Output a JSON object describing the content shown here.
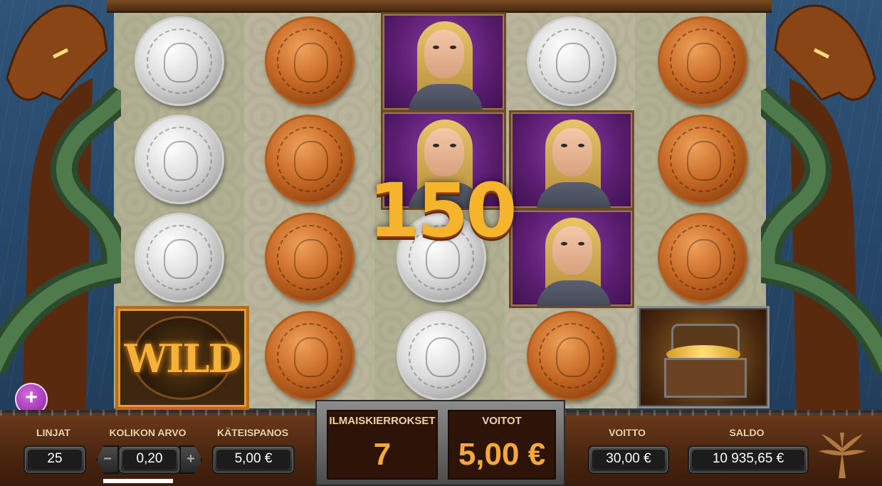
{
  "game": {
    "win_popup": "150",
    "wild_label": "WILD"
  },
  "reels": {
    "columns": [
      [
        "silver-coin",
        "silver-coin",
        "silver-coin",
        "wild"
      ],
      [
        "copper-coin",
        "copper-coin",
        "copper-coin",
        "copper-coin"
      ],
      [
        "viking-girl",
        "viking-girl",
        "silver-coin",
        "silver-coin"
      ],
      [
        "silver-coin",
        "viking-girl",
        "viking-girl",
        "copper-coin"
      ],
      [
        "copper-coin",
        "copper-coin",
        "copper-coin",
        "treasure-chest"
      ]
    ]
  },
  "controls": {
    "lines_label": "LINJAT",
    "lines_value": "25",
    "coin_value_label": "KOLIKON ARVO",
    "coin_value": "0,20",
    "decrease_symbol": "−",
    "increase_symbol": "+",
    "cash_bet_label": "KÄTEISPANOS",
    "cash_bet_value": "5,00 €",
    "free_spins_label": "ILMAISKIERROKSET",
    "free_spins_value": "7",
    "wins_label": "VOITOT",
    "wins_value": "5,00 €",
    "win_label": "VOITTO",
    "win_value": "30,00 €",
    "balance_label": "SALDO",
    "balance_value": "10 935,65 €",
    "menu_symbol": "+"
  },
  "colors": {
    "accent_gold": "#f6b32c",
    "panel_brown": "#4a250f",
    "menu_purple": "#8a1e9e"
  },
  "icons": [
    "dragon-prow-icon",
    "plus-icon",
    "yggdrasil-logo-icon"
  ]
}
